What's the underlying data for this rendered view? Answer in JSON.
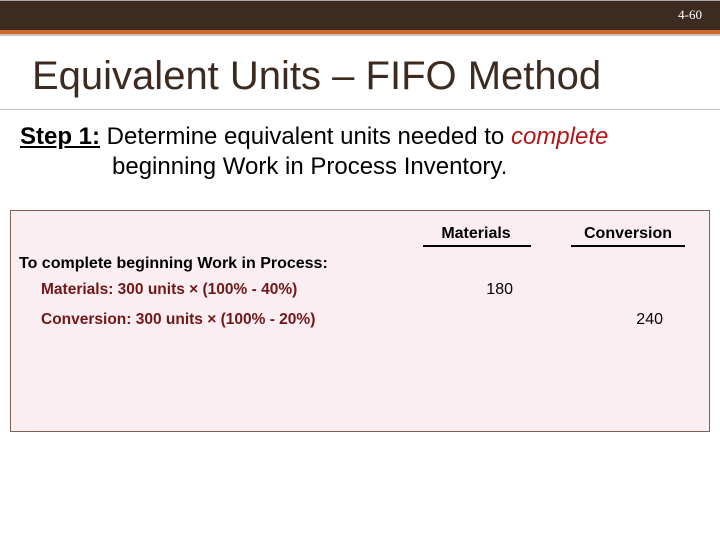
{
  "page_number": "4-60",
  "title": "Equivalent Units – FIFO Method",
  "step": {
    "label": "Step 1:",
    "part1": " Determine equivalent units needed to ",
    "italic": "complete",
    "part2": "beginning Work in Process Inventory."
  },
  "table": {
    "columns": {
      "materials": "Materials",
      "conversion": "Conversion"
    },
    "section_head": "To complete beginning Work in Process:",
    "rows": {
      "materials": {
        "calc": "Materials: 300 units × (100% - 40%)",
        "value": "180"
      },
      "conversion": {
        "calc": "Conversion: 300 units × (100% - 20%)",
        "value": "240"
      }
    }
  }
}
